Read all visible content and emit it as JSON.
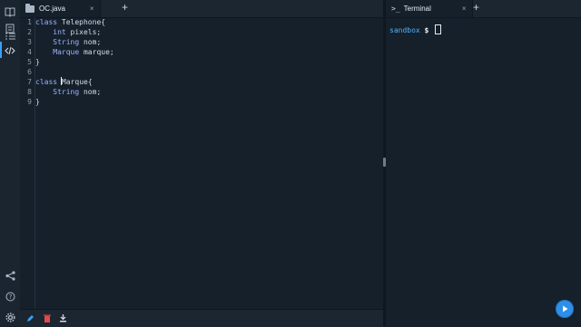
{
  "editor": {
    "tab_label": "OC.java",
    "close_symbol": "×",
    "new_tab_symbol": "+",
    "line_numbers": [
      "1",
      "2",
      "3",
      "4",
      "5",
      "6",
      "7",
      "8",
      "9"
    ],
    "lines": [
      "class Telephone{",
      "    int pixels;",
      "    String nom;",
      "    Marque marque;",
      "}",
      "",
      "class Marque{",
      "    String nom;",
      "}"
    ]
  },
  "terminal": {
    "tab_label": "Terminal",
    "tab_prompt_icon": ">_",
    "close_symbol": "×",
    "new_tab_symbol": "+",
    "host": "sandbox",
    "prompt": "$"
  },
  "colors": {
    "accent": "#3aa0ff",
    "keyword": "#9db4ff",
    "background": "#15202b",
    "run_button": "#2f8fe8",
    "delete_icon": "#e24a4a"
  },
  "icons": {
    "rail_top": [
      "book-icon",
      "folder-icon",
      "checklist-icon",
      "code-icon"
    ],
    "rail_bottom": [
      "share-icon",
      "help-icon",
      "settings-icon"
    ],
    "footer": [
      "pencil-icon",
      "trash-icon",
      "download-icon"
    ],
    "run": "play-icon"
  }
}
